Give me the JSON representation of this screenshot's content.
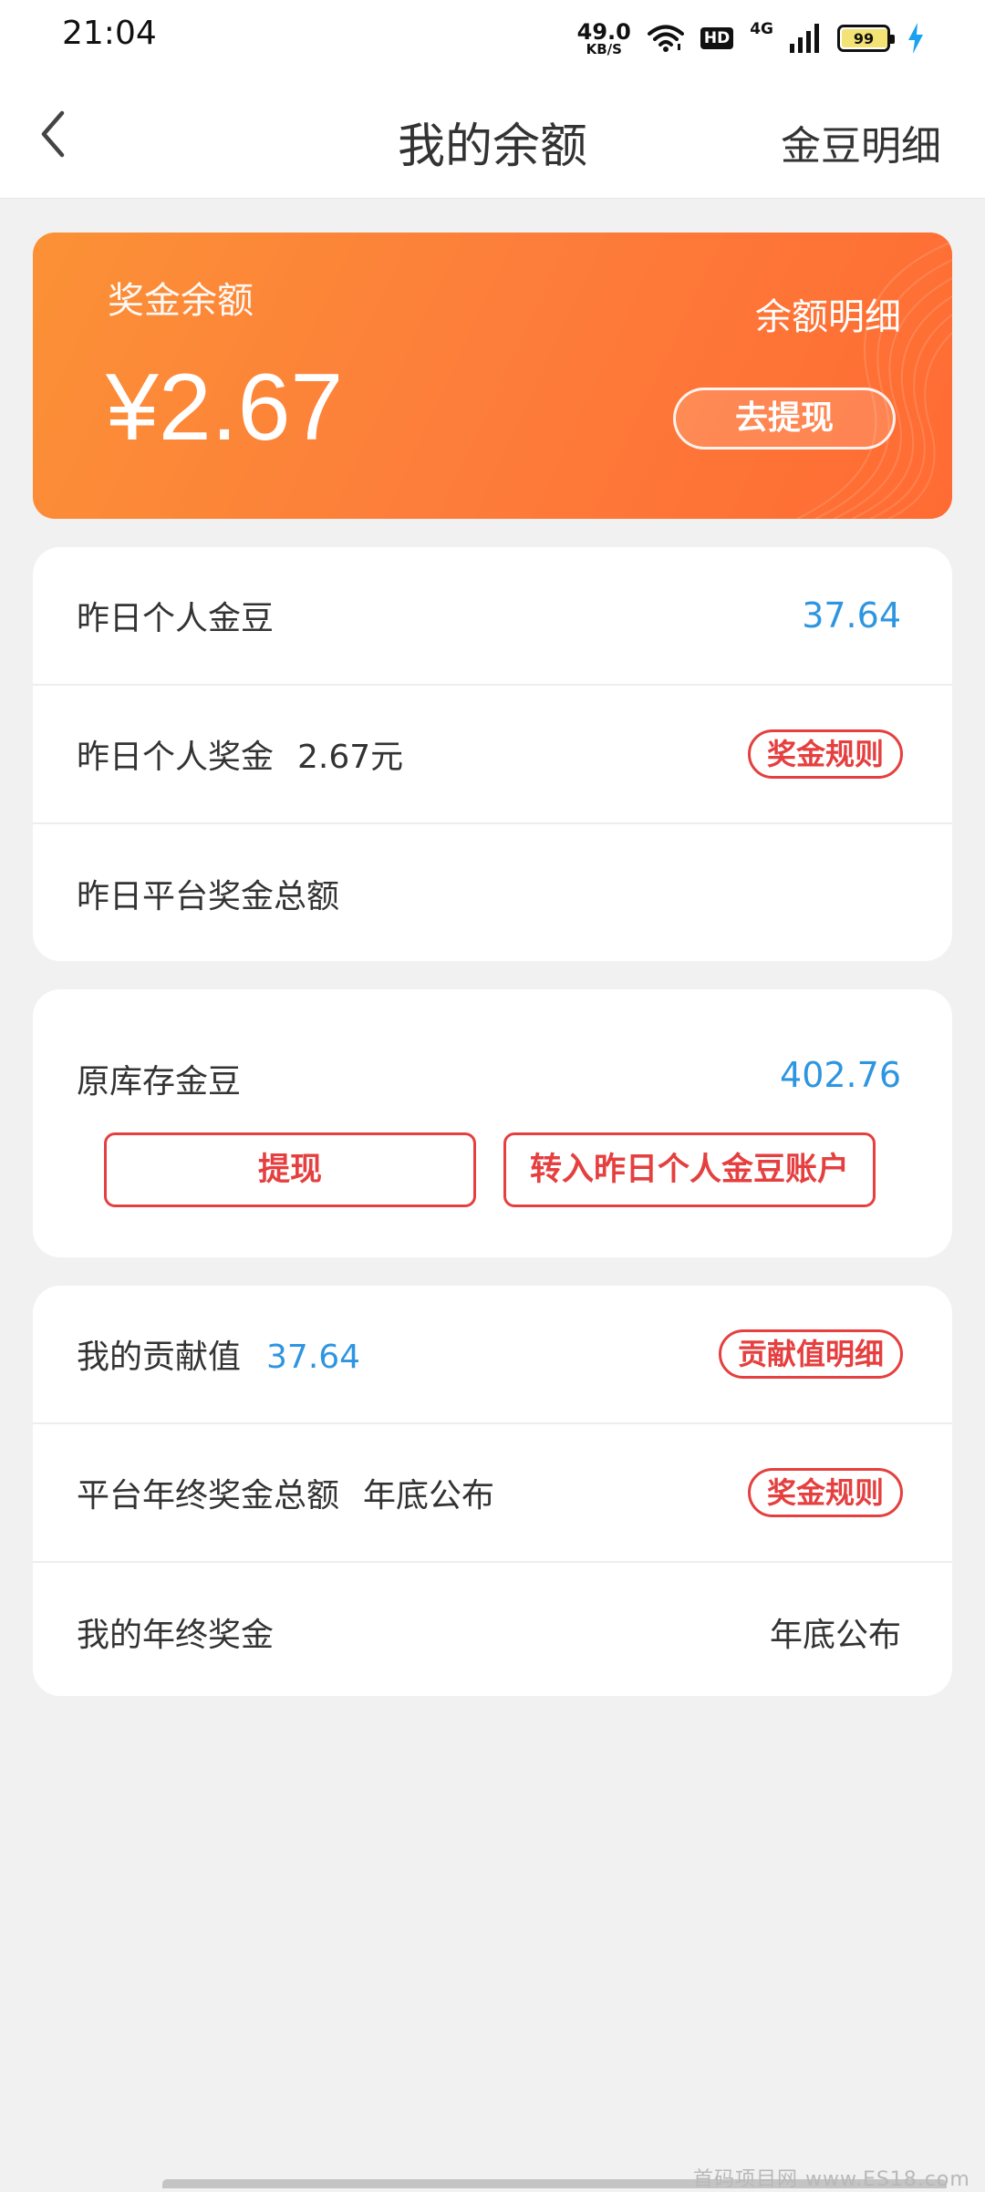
{
  "status_bar": {
    "time": "21:04",
    "net_speed_value": "49.0",
    "net_speed_unit": "KB/S",
    "hd_badge": "HD",
    "network_type": "4G",
    "battery_level": "99",
    "icons": [
      "wifi-icon",
      "signal-icon",
      "battery-icon",
      "charging-icon"
    ]
  },
  "nav": {
    "back_icon": "chevron-left-icon",
    "title": "我的余额",
    "right_link": "金豆明细"
  },
  "hero": {
    "label": "奖金余额",
    "amount": "¥2.67",
    "detail_link": "余额明细",
    "withdraw_button": "去提现",
    "gradient_start": "#fb9136",
    "gradient_end": "#ff6b33"
  },
  "daily": {
    "rows": [
      {
        "label": "昨日个人金豆",
        "value": "37.64"
      },
      {
        "label": "昨日个人奖金",
        "inline_value": "2.67元",
        "action": "奖金规则"
      },
      {
        "label": "昨日平台奖金总额"
      }
    ]
  },
  "stock": {
    "label": "原库存金豆",
    "value": "402.76",
    "withdraw_button": "提现",
    "transfer_button": "转入昨日个人金豆账户"
  },
  "annual": {
    "rows": [
      {
        "label": "我的贡献值",
        "inline_value": "37.64",
        "action": "贡献值明细"
      },
      {
        "label": "平台年终奖金总额",
        "inline_value": "年底公布",
        "action": "奖金规则"
      },
      {
        "label": "我的年终奖金",
        "value": "年底公布"
      }
    ]
  },
  "colors": {
    "accent_blue": "#2e95e0",
    "accent_red": "#e53f3f",
    "background": "#f1f1f1"
  },
  "watermark": "首码项目网 www.ES18.com"
}
